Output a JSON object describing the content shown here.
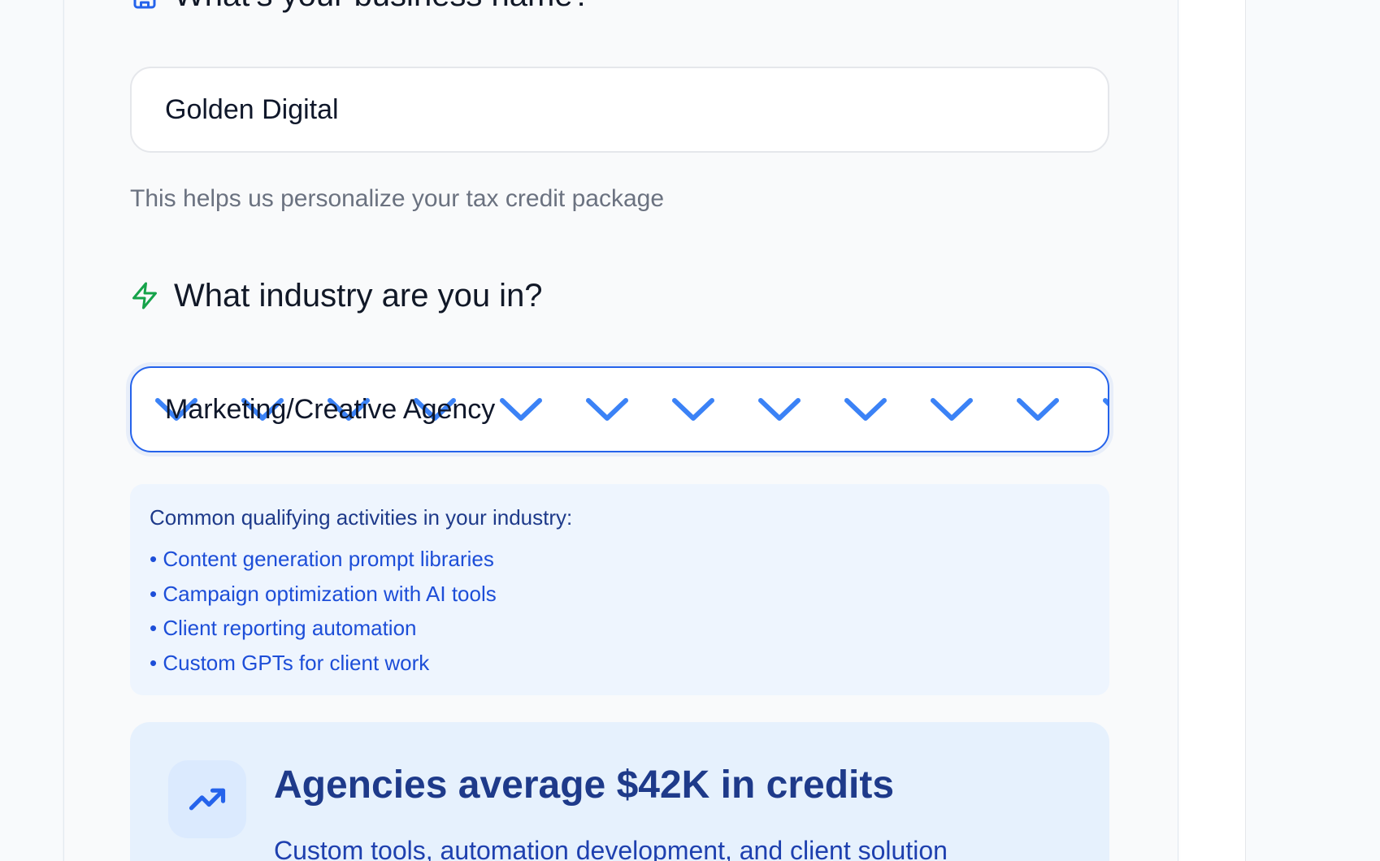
{
  "business_name": {
    "question": "What’s your business name?",
    "value": "Golden Digital",
    "helper": "This helps us personalize your tax credit package",
    "icon": "building-icon"
  },
  "industry": {
    "question": "What industry are you in?",
    "selected_value": "Marketing/Creative Agency",
    "icon": "lightning-icon",
    "chevron_icon": "chevron-down-icon"
  },
  "qualifying": {
    "title": "Common qualifying activities in your industry:",
    "items": [
      "• Content generation prompt libraries",
      "• Campaign optimization with AI tools",
      "• Client reporting automation",
      "• Custom GPTs for client work"
    ]
  },
  "stat": {
    "title": "Agencies average $42K in credits",
    "subtitle": "Custom tools, automation development, and client solution",
    "icon": "trending-up-icon"
  },
  "colors": {
    "accent": "#2563eb",
    "lightning": "#16a34a",
    "heading": "#111827",
    "helper": "#6b7280",
    "info_bg": "#eef5fe",
    "stat_bg": "#e6f1fd"
  }
}
